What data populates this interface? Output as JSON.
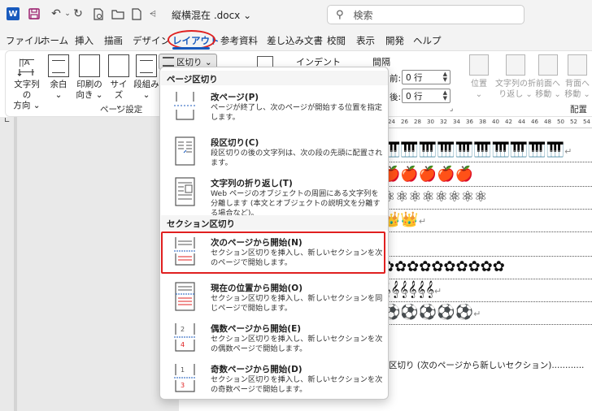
{
  "titlebar": {
    "app_logo": "W",
    "doc_title": "縦横混在 .docx ⌄",
    "search_placeholder": "検索",
    "icons": [
      "save-icon",
      "undo-icon",
      "redo-icon",
      "print-preview-icon",
      "open-icon",
      "new-document-icon",
      "qat-more-icon"
    ]
  },
  "tabs": [
    {
      "label": "ファイル"
    },
    {
      "label": "ホーム"
    },
    {
      "label": "挿入"
    },
    {
      "label": "描画"
    },
    {
      "label": "デザイン"
    },
    {
      "label": "レイアウト"
    },
    {
      "label": "参考資料"
    },
    {
      "label": "差し込み文書"
    },
    {
      "label": "校閲"
    },
    {
      "label": "表示"
    },
    {
      "label": "開発"
    },
    {
      "label": "ヘルプ"
    }
  ],
  "ribbon": {
    "text_direction": {
      "line1": "文字列の",
      "line2": "方向 ⌄"
    },
    "margins": {
      "line1": "余白",
      "line2": "⌄"
    },
    "orientation": {
      "line1": "印刷の",
      "line2": "向き ⌄"
    },
    "size": {
      "line1": "サイズ",
      "line2": "⌄"
    },
    "columns": {
      "line1": "段組み",
      "line2": "⌄"
    },
    "breaks_button": "区切り ⌄",
    "page_setup_label": "ページ設定",
    "indent_label": "インデント",
    "spacing_label": "間隔",
    "before_label": "前:",
    "before_value": "0 行",
    "after_label": "後:",
    "after_value": "0 行",
    "position": {
      "line1": "位置",
      "line2": "⌄"
    },
    "wrap_text": {
      "line1": "文字列の折",
      "line2": "り返し ⌄"
    },
    "bring_forward": {
      "line1": "前面へ",
      "line2": "移動 ⌄"
    },
    "send_backward": {
      "line1": "背面へ",
      "line2": "移動 ⌄"
    },
    "arrange_label": "配置"
  },
  "ruler_ticks": [
    "24",
    "26",
    "28",
    "30",
    "32",
    "34",
    "36",
    "38",
    "40",
    "42",
    "44",
    "46",
    "48",
    "50",
    "52",
    "54"
  ],
  "document": {
    "lines": [
      "🎹🎹🎹🎹🎹🎹🎹🎹🎹🎹",
      "🍎🍎🍎🍎🍎",
      "⚛⚛⚛⚛⚛⚛⚛⚛",
      "👑👑",
      "",
      "✿✿✿✿✿✿✿✿✿✿",
      "𝄞𝄞𝄞𝄞𝄞𝄞",
      "⚽⚽⚽⚽⚽"
    ],
    "return_mark": "↵",
    "section_break": "区切り (次のページから新しいセクション)"
  },
  "breaks_menu": {
    "page_breaks_header": "ページ区切り",
    "section_breaks_header": "セクション区切り",
    "items": [
      {
        "title": "改ページ(P)",
        "desc": "ページが終了し、次のページが開始する位置を指定します。"
      },
      {
        "title": "段区切り(C)",
        "desc": "段区切りの後の文字列は、次の段の先頭に配置されます。"
      },
      {
        "title": "文字列の折り返し(T)",
        "desc": "Web ページのオブジェクトの周囲にある文字列を分離します (本文とオブジェクトの説明文を分離する場合など)。"
      },
      {
        "title": "次のページから開始(N)",
        "desc": "セクション区切りを挿入し、新しいセクションを次のページで開始します。"
      },
      {
        "title": "現在の位置から開始(O)",
        "desc": "セクション区切りを挿入し、新しいセクションを同じページで開始します。"
      },
      {
        "title": "偶数ページから開始(E)",
        "desc": "セクション区切りを挿入し、新しいセクションを次の偶数ページで開始します。"
      },
      {
        "title": "奇数ページから開始(D)",
        "desc": "セクション区切りを挿入し、新しいセクションを次の奇数ページで開始します。"
      }
    ]
  },
  "colors": {
    "accent": "#185abd",
    "highlight": "#e02020",
    "ribbon_bg": "#f3f3f3"
  }
}
